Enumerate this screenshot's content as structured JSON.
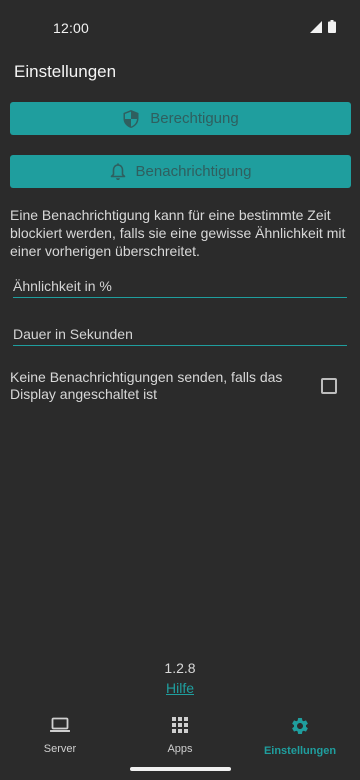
{
  "status_bar": {
    "time": "12:00"
  },
  "page": {
    "title": "Einstellungen"
  },
  "buttons": {
    "permission_label": "Berechtigung",
    "notification_label": "Benachrichtigung"
  },
  "description": "Eine Benachrichtigung kann für eine bestimmte Zeit blockiert werden, falls sie eine gewisse Ähnlichkeit mit einer vorherigen überschreitet.",
  "fields": {
    "similarity_placeholder": "Ähnlichkeit in %",
    "duration_placeholder": "Dauer in Sekunden"
  },
  "checkbox": {
    "label": "Keine Benachrichtigungen senden, falls das Display angeschaltet ist",
    "checked": false
  },
  "footer": {
    "version": "1.2.8",
    "help_link": "Hilfe"
  },
  "bottom_nav": {
    "items": [
      {
        "label": "Server",
        "icon": "laptop-icon",
        "active": false
      },
      {
        "label": "Apps",
        "icon": "grid-icon",
        "active": false
      },
      {
        "label": "Einstellungen",
        "icon": "gear-icon",
        "active": true
      }
    ]
  },
  "colors": {
    "accent": "#1f9e9e",
    "background": "#2b2b2b"
  }
}
